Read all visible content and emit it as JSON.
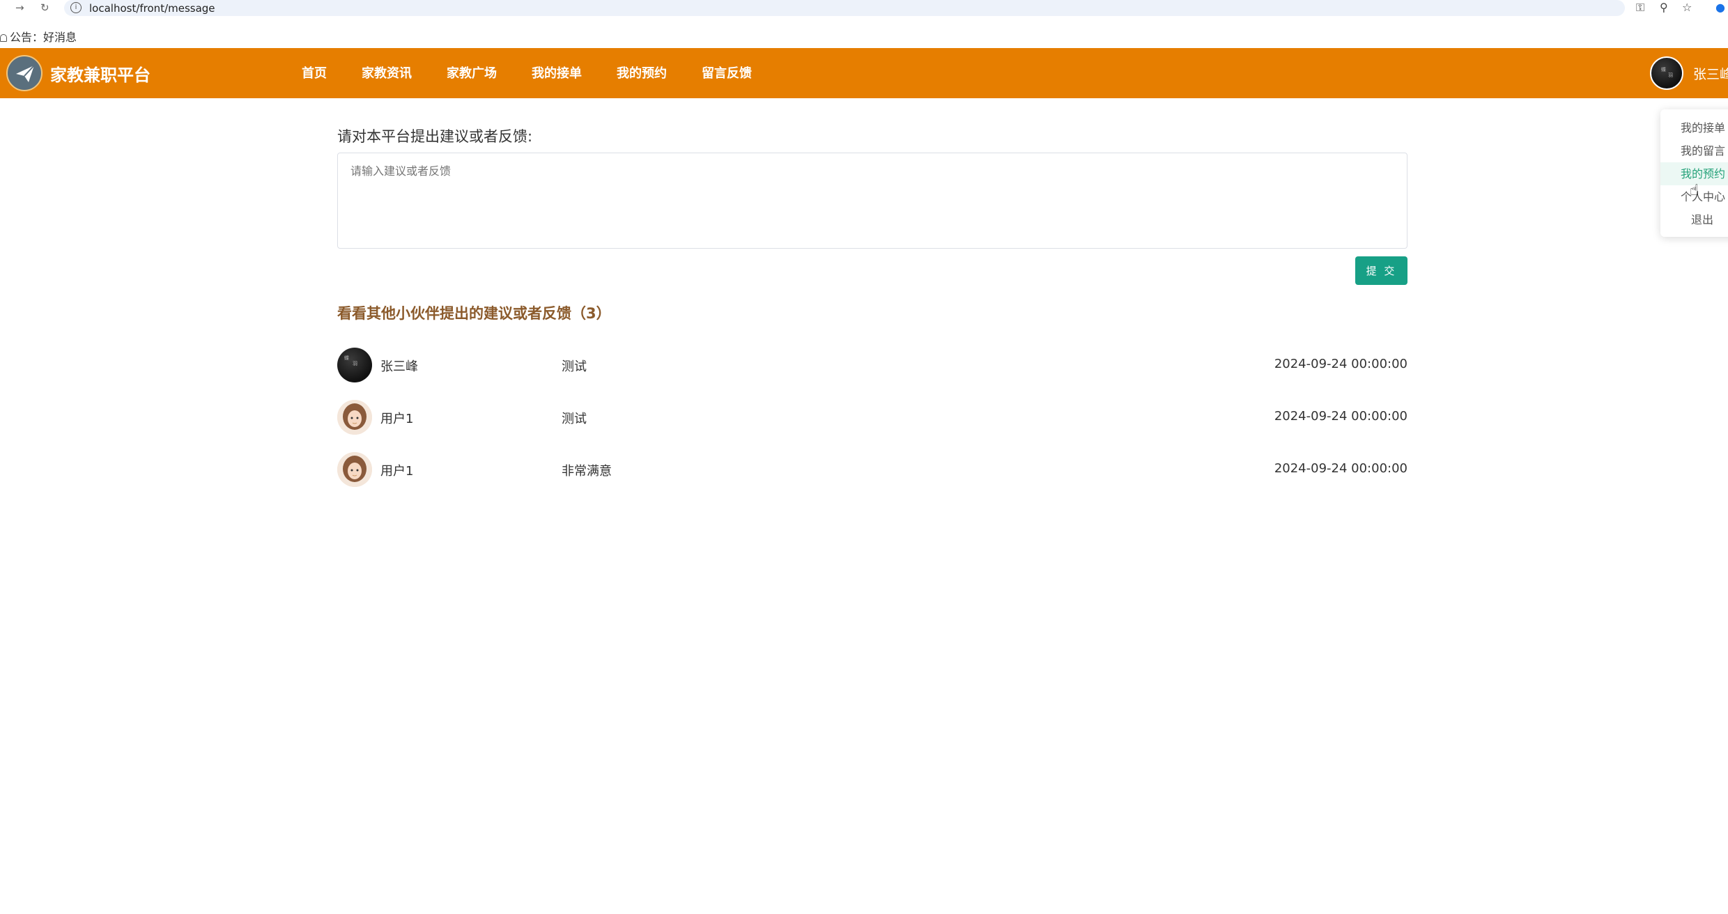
{
  "browser": {
    "url": "localhost/front/message"
  },
  "notice": {
    "text": "公告：好消息"
  },
  "header": {
    "title": "家教兼职平台",
    "brand_color": "#e67e00",
    "menu": [
      "首页",
      "家教资讯",
      "家教广场",
      "我的接单",
      "我的预约",
      "留言反馈"
    ],
    "user_name": "张三峰"
  },
  "dropdown": {
    "items": [
      "我的接单",
      "我的留言",
      "我的预约",
      "个人中心",
      "退出"
    ],
    "active_item": "我的预约",
    "active_color": "#26a27a"
  },
  "form": {
    "prompt": "请对本平台提出建议或者反馈:",
    "placeholder": "请输入建议或者反馈",
    "submit_label": "提 交",
    "button_color": "#17a086"
  },
  "feedback": {
    "title": "看看其他小伙伴提出的建议或者反馈（3）",
    "title_color": "#8b5a2b",
    "items": [
      {
        "user": "张三峰",
        "content": "测试",
        "time": "2024-09-24 00:00:00",
        "avatar": "dark-avatar"
      },
      {
        "user": "用户1",
        "content": "测试",
        "time": "2024-09-24 00:00:00",
        "avatar": "girl-avatar"
      },
      {
        "user": "用户1",
        "content": "非常满意",
        "time": "2024-09-24 00:00:00",
        "avatar": "girl-avatar"
      }
    ]
  }
}
